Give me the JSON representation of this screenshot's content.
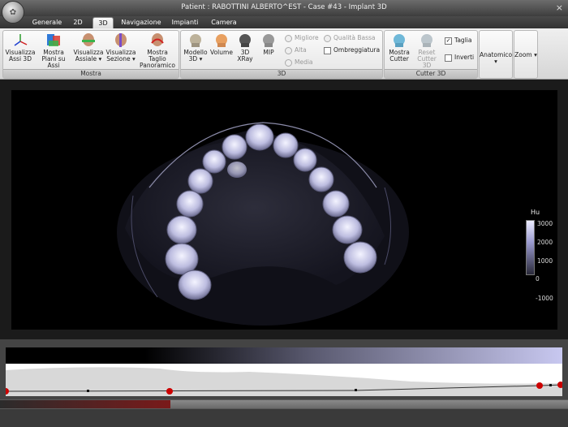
{
  "window": {
    "title": "Patient : RABOTTINI ALBERTO^EST - Case #43 - Implant 3D",
    "close": "×"
  },
  "tabs": [
    {
      "label": "Generale",
      "active": false
    },
    {
      "label": "2D",
      "active": false
    },
    {
      "label": "3D",
      "active": true
    },
    {
      "label": "Navigazione",
      "active": false
    },
    {
      "label": "Impianti",
      "active": false
    },
    {
      "label": "Camera",
      "active": false
    }
  ],
  "ribbon": {
    "groups": {
      "mostra": "Mostra",
      "d3": "3D",
      "cutter": "Cutter 3D"
    },
    "buttons": {
      "visualizza_assi": "Visualizza Assi 3D",
      "mostra_piani": "Mostra Piani su Assi",
      "visualizza_assiale": "Visualizza Assiale ▾",
      "visualizza_sezione": "Visualizza Sezione ▾",
      "mostra_taglio": "Mostra Taglio Panoramico ▾",
      "modello": "Modello 3D ▾",
      "volume": "Volume",
      "xray": "3D XRay",
      "mip": "MIP",
      "mostra_cutter": "Mostra Cutter",
      "reset_cutter": "Reset Cutter 3D",
      "anatomico": "Anatomico ▾",
      "zoom": "Zoom ▾"
    },
    "quality": {
      "migliore": "Migliore",
      "alta": "Alta",
      "media": "Media",
      "bassa": "Qualità Bassa"
    },
    "ombreggiatura": "Ombreggiatura",
    "taglia": "Taglia",
    "inverti": "Inverti",
    "taglia_checked": true,
    "inverti_checked": false,
    "ombreggiatura_checked": false
  },
  "colorbar": {
    "unit": "Hu",
    "ticks": [
      "3000",
      "2000",
      "1000",
      "0",
      "-1000"
    ]
  },
  "colors": {
    "accent": "#c8c8ff",
    "marker": "#cc0000"
  }
}
